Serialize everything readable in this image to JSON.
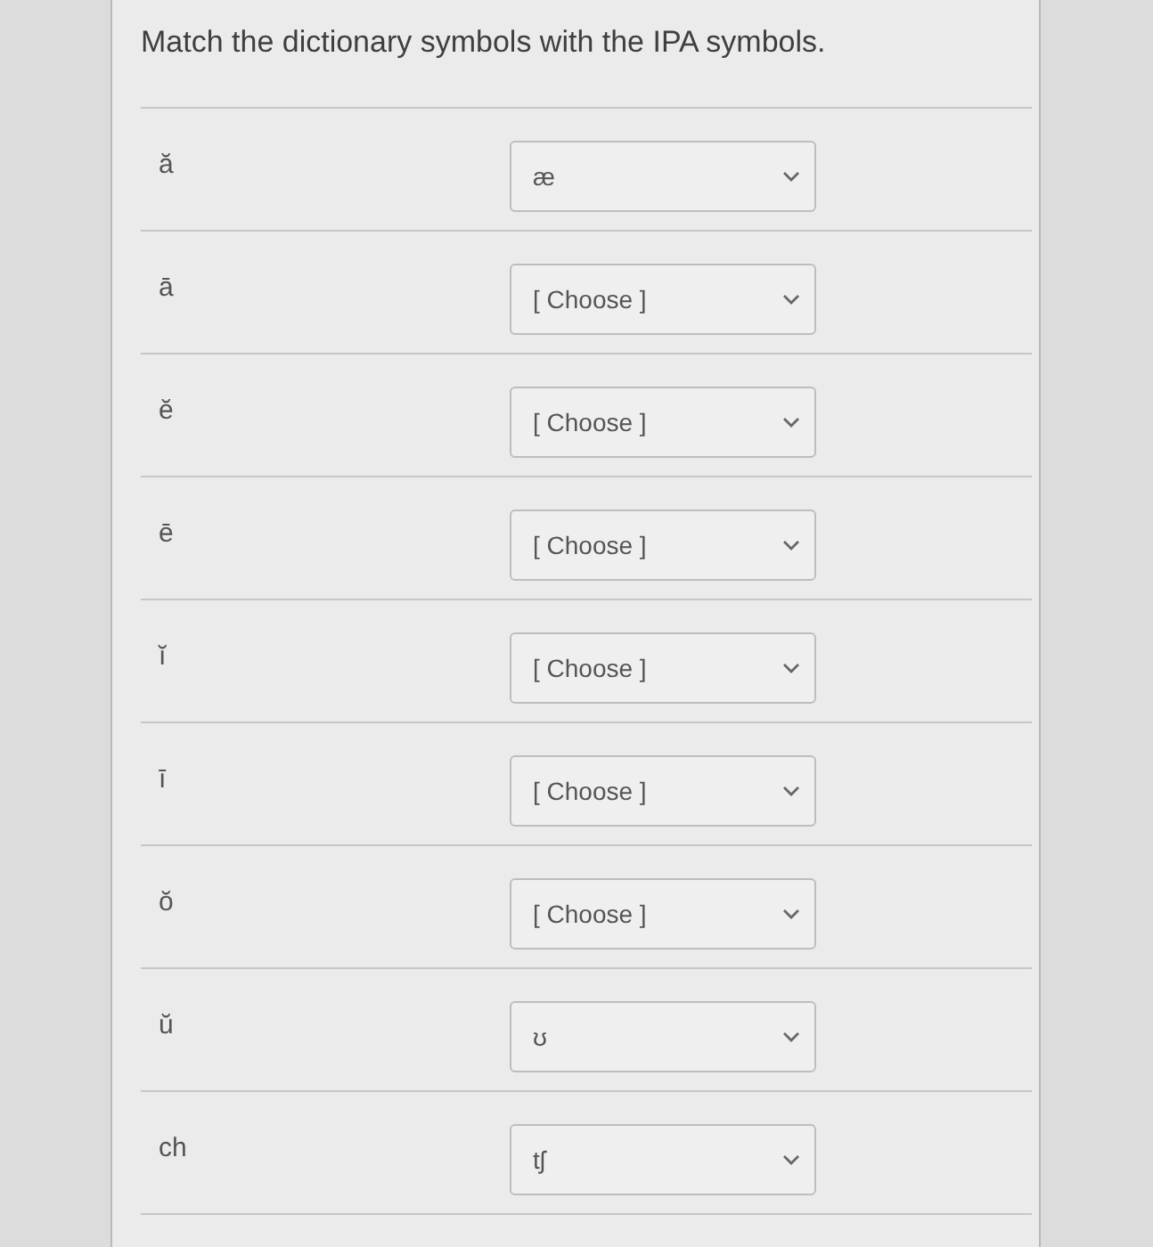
{
  "question": {
    "prompt": "Match the dictionary symbols with the IPA symbols."
  },
  "pairs": [
    {
      "symbol": "ă",
      "selected_option": "æ"
    },
    {
      "symbol": "ā",
      "selected_option": "[ Choose ]"
    },
    {
      "symbol": "ĕ",
      "selected_option": "[ Choose ]"
    },
    {
      "symbol": "ē",
      "selected_option": "[ Choose ]"
    },
    {
      "symbol": "ĭ",
      "selected_option": "[ Choose ]"
    },
    {
      "symbol": "ī",
      "selected_option": "[ Choose ]"
    },
    {
      "symbol": "ŏ",
      "selected_option": "[ Choose ]"
    },
    {
      "symbol": "ŭ",
      "selected_option": "ʊ"
    },
    {
      "symbol": "ch",
      "selected_option": "tʃ"
    }
  ]
}
